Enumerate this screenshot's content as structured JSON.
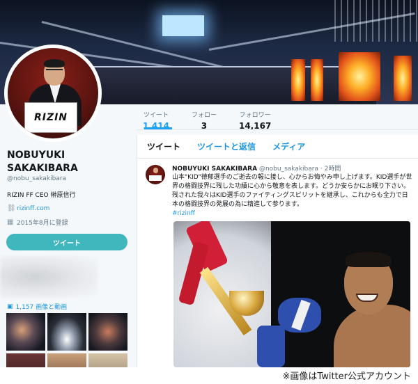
{
  "stats": [
    {
      "label": "ツイート",
      "value": "1,414"
    },
    {
      "label": "フォロー",
      "value": "3"
    },
    {
      "label": "フォロワー",
      "value": "14,167"
    }
  ],
  "profile": {
    "avatar_sign": "RIZIN",
    "name": "NOBUYUKI SAKAKIBARA",
    "handle": "@nobu_sakakibara",
    "bio": "RIZIN FF CEO 榊原信行",
    "link": "rizinff.com",
    "joined": "2015年8月に登録",
    "tweet_button": "ツイート",
    "media_label": "1,157 画像と動画"
  },
  "tabs": [
    "ツイート",
    "ツイートと返信",
    "メディア"
  ],
  "tweet": {
    "author": "NOBUYUKI SAKAKIBARA",
    "handle": "@nobu_sakakibara",
    "time": "· 2時間",
    "body": "山本\"KID\"徳郁選手のご逝去の報に接し、心からお悔やみ申し上げます。KID選手が世界の格闘技界に残した功績に心から敬意を表します。どうか安らかにお眠り下さい。残された我々はKID選手のファイティングスピリットを継承し、これからも全力で日本の格闘技界の発展の為に精進して参ります。",
    "hashtag": "#rizinff"
  },
  "caption": "※画像はTwitter公式アカウント",
  "colors": {
    "accent": "#1da1f2",
    "link": "#1b95e0",
    "tweet_button": "#40b6bd"
  }
}
